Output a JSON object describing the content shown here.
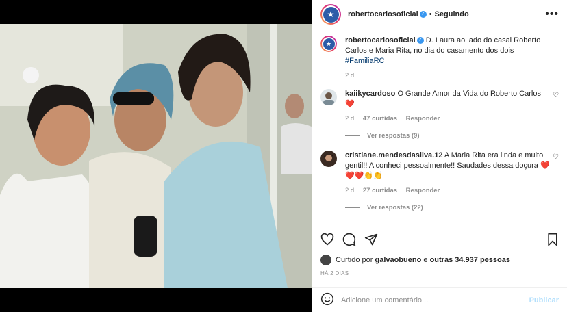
{
  "post": {
    "photo_alt": "Foto: D. Laura ao lado do casal Roberto Carlos e Maria Rita"
  },
  "header": {
    "username": "robertocarlosoficial",
    "separator": "•",
    "follow_label": "Seguindo",
    "more_icon": "more-horizontal-icon"
  },
  "caption": {
    "username": "robertocarlosoficial",
    "text": "D. Laura ao lado do casal Roberto Carlos e Maria Rita, no dia do casamento dos dois",
    "hashtag": "#FamiliaRC",
    "time": "2 d"
  },
  "comments": [
    {
      "username": "kaiikycardoso",
      "text": "O Grande Amor da Vida do Roberto Carlos ❤️",
      "time": "2 d",
      "likes": "47 curtidas",
      "reply_label": "Responder",
      "view_replies": "Ver respostas (9)"
    },
    {
      "username": "cristiane.mendesdasilva.12",
      "text": "A Maria Rita era linda e muito gentil!! A conheci pessoalmente!! Saudades dessa doçura ❤️",
      "emoji_line": "❤️❤️👏👏",
      "time": "2 d",
      "likes": "27 curtidas",
      "reply_label": "Responder",
      "view_replies": "Ver respostas (22)"
    }
  ],
  "likes": {
    "prefix": "Curtido por",
    "user": "galvaobueno",
    "middle": "e",
    "others": "outras 34.937 pessoas"
  },
  "date": "HÁ 2 DIAS",
  "comment_box": {
    "placeholder": "Adicione um comentário...",
    "publish_label": "Publicar"
  },
  "colors": {
    "verified": "#3897f0",
    "link": "#00376b",
    "muted": "#8e8e8e",
    "publish_disabled": "#b2dffc"
  }
}
